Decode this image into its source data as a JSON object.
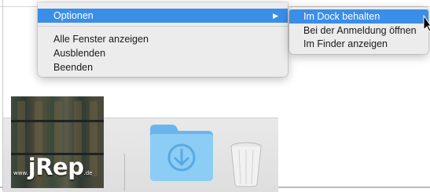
{
  "context_menu": {
    "items": [
      {
        "label": "Optionen",
        "highlighted": true,
        "has_submenu": true
      },
      {
        "label": "Alle Fenster anzeigen",
        "highlighted": false
      },
      {
        "label": "Ausblenden",
        "highlighted": false
      },
      {
        "label": "Beenden",
        "highlighted": false
      }
    ],
    "submenu_arrow": "▶"
  },
  "submenu": {
    "items": [
      {
        "label": "Im Dock behalten",
        "highlighted": true
      },
      {
        "label": "Bei der Anmeldung öffnen",
        "highlighted": false
      },
      {
        "label": "Im Finder anzeigen",
        "highlighted": false
      }
    ]
  },
  "dock": {
    "app_icon": {
      "mark_prefix": "www.",
      "mark_main": "jRep",
      "mark_suffix": ".de"
    },
    "folder_icon": "downloads-folder-icon",
    "trash_icon": "trash-icon"
  },
  "colors": {
    "highlight": "#3a8ee8",
    "menu_bg": "#ececec",
    "folder_blue": "#7cc3f2"
  }
}
